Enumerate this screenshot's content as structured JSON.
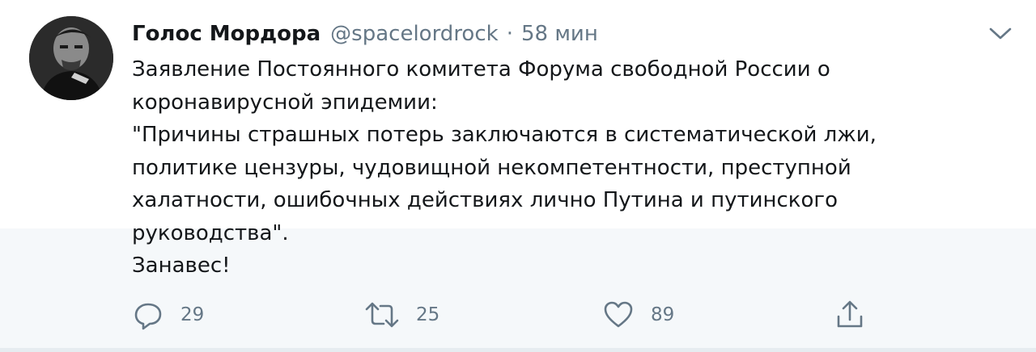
{
  "tweet": {
    "author": {
      "display_name": "Голос Мордора",
      "handle": "@spacelordrock",
      "avatar_icon": "user-avatar-photo"
    },
    "separator": "·",
    "timestamp": "58 мин",
    "text_lines": [
      "Заявление Постоянного комитета Форума свободной России о",
      "коронавирусной эпидемии:",
      "\"Причины страшных потерь заключаются в систематической лжи,",
      "политике цензуры, чудовищной некомпетентности, преступной",
      "халатности, ошибочных действиях лично Путина и путинского",
      "руководства\".",
      "Занавес!"
    ],
    "actions": {
      "reply": {
        "icon": "reply-icon",
        "count": "29"
      },
      "retweet": {
        "icon": "retweet-icon",
        "count": "25"
      },
      "like": {
        "icon": "heart-icon",
        "count": "89"
      },
      "share": {
        "icon": "share-icon"
      }
    },
    "menu_icon": "chevron-down-icon"
  },
  "colors": {
    "text": "#14171a",
    "secondary": "#657786",
    "accent": "#1da1f2",
    "background": "#ffffff",
    "band": "#f5f8fa"
  }
}
